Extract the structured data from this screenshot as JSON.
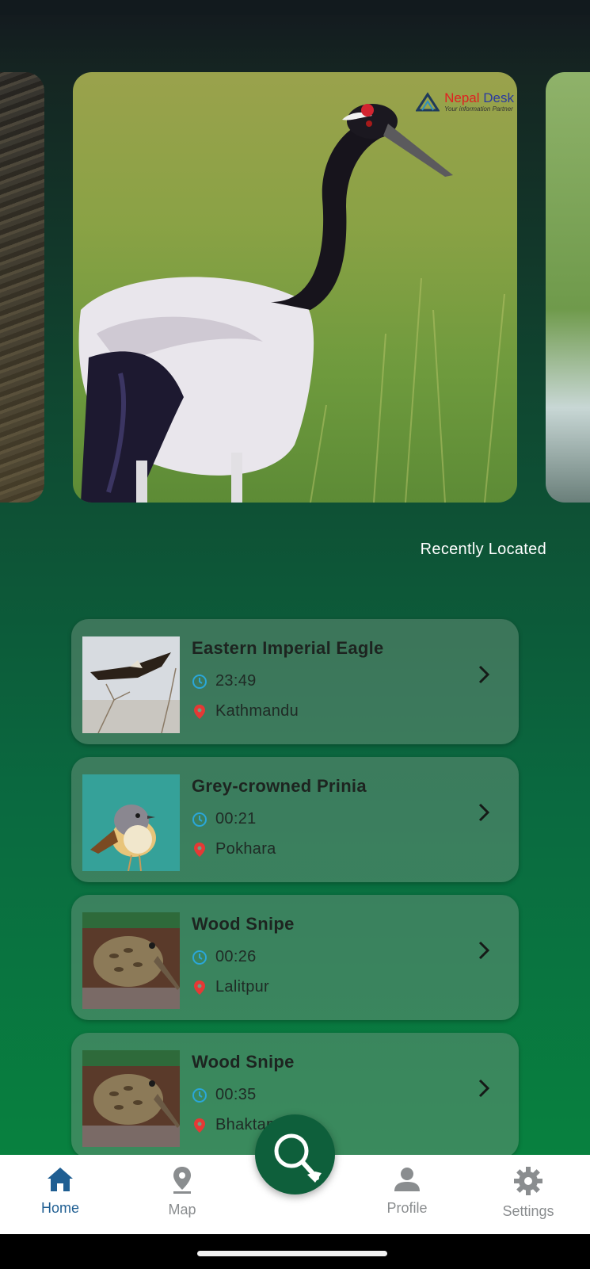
{
  "carousel": {
    "watermark_brand_1": "Nepal",
    "watermark_brand_2": "Desk",
    "watermark_tagline": "Your information Partner"
  },
  "section": {
    "title": "Recently Located"
  },
  "recent": [
    {
      "name": "Eastern Imperial Eagle",
      "time": "23:49",
      "location": "Kathmandu"
    },
    {
      "name": "Grey-crowned Prinia",
      "time": "00:21",
      "location": "Pokhara"
    },
    {
      "name": "Wood Snipe",
      "time": "00:26",
      "location": "Lalitpur"
    },
    {
      "name": "Wood Snipe",
      "time": "00:35",
      "location": "Bhaktapur"
    }
  ],
  "nav": {
    "home": "Home",
    "map": "Map",
    "profile": "Profile",
    "settings": "Settings"
  },
  "colors": {
    "accent_active": "#1f5e92",
    "fab": "#0e5f3b",
    "clock_icon": "#2aa7d9",
    "pin_icon": "#e53935"
  },
  "icons": {
    "nav_home": "home-icon",
    "nav_map": "map-pin-icon",
    "nav_profile": "person-icon",
    "nav_settings": "gear-icon",
    "fab": "search-icon",
    "row_time": "clock-icon",
    "row_location": "location-pin-icon",
    "row_action": "chevron-right-icon"
  }
}
